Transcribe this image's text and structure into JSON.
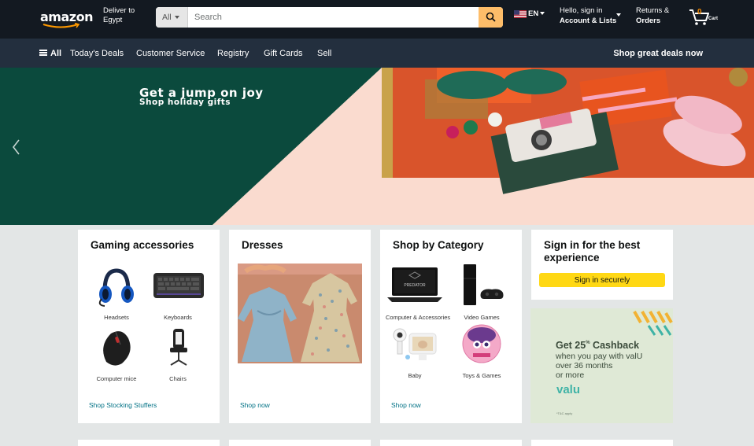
{
  "header": {
    "logo_text": "amazon",
    "deliver_line1": "Deliver to",
    "deliver_line2": "Egypt",
    "search_category": "All",
    "search_placeholder": "Search",
    "language": "EN",
    "account_line1": "Hello, sign in",
    "account_line2": "Account & Lists",
    "returns_line1": "Returns &",
    "returns_line2": "Orders",
    "cart_count": "0",
    "cart_label": "Cart",
    "icons": [
      "search-icon",
      "us-flag-icon",
      "cart-icon",
      "chevron-down-icon"
    ]
  },
  "nav": {
    "all_label": "All",
    "items": [
      "Today's Deals",
      "Customer Service",
      "Registry",
      "Gift Cards",
      "Sell"
    ],
    "promo": "Shop great deals now"
  },
  "hero": {
    "title": "Get a jump on joy",
    "subtitle": "Shop holiday gifts"
  },
  "cards": {
    "gaming": {
      "title": "Gaming accessories",
      "tiles": [
        "Headsets",
        "Keyboards",
        "Computer mice",
        "Chairs"
      ],
      "link": "Shop Stocking Stuffers"
    },
    "dresses": {
      "title": "Dresses",
      "link": "Shop now"
    },
    "category": {
      "title": "Shop by Category",
      "tiles": [
        "Computer & Accessories",
        "Video Games",
        "Baby",
        "Toys & Games"
      ],
      "laptop_brand": "PREDATOR",
      "link": "Shop now"
    },
    "signin": {
      "title": "Sign in for the best experience",
      "button": "Sign in securely"
    },
    "valu": {
      "headline": "Get 25",
      "headline_sup": "%",
      "headline_rest": "Cashback",
      "line1": "when you pay with valU",
      "line2": "over 36 months",
      "line3": "or more",
      "brand": "valu",
      "note": "*T&C apply"
    }
  },
  "colors": {
    "nav_top": "#131921",
    "nav_main": "#232f3e",
    "search_button": "#febd69",
    "signin_button": "#ffd814",
    "link": "#007185",
    "hero_green": "#0b4a3d",
    "hero_peach": "#fadbcf"
  }
}
